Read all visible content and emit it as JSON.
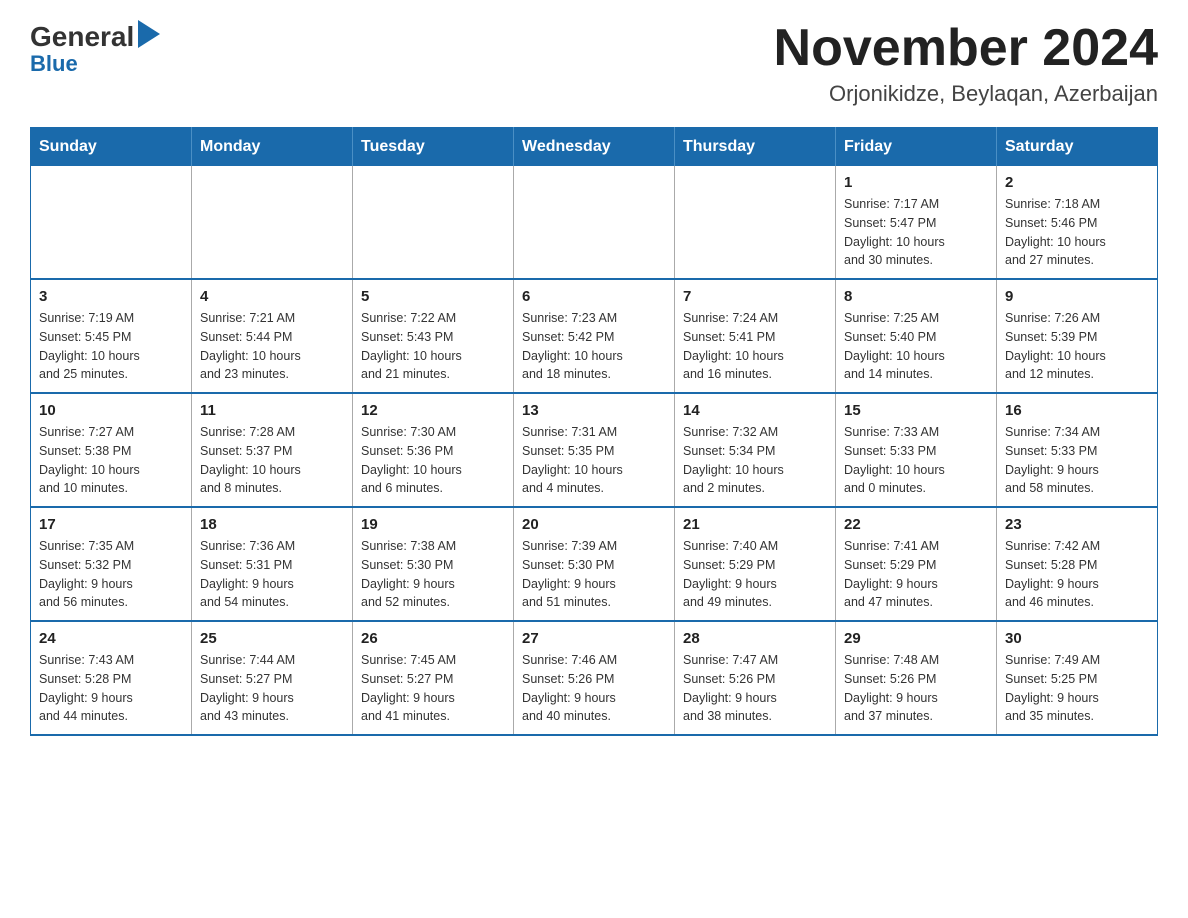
{
  "header": {
    "logo_general": "General",
    "logo_blue": "Blue",
    "month_title": "November 2024",
    "location": "Orjonikidze, Beylaqan, Azerbaijan"
  },
  "calendar": {
    "weekdays": [
      "Sunday",
      "Monday",
      "Tuesday",
      "Wednesday",
      "Thursday",
      "Friday",
      "Saturday"
    ],
    "weeks": [
      [
        {
          "day": "",
          "info": ""
        },
        {
          "day": "",
          "info": ""
        },
        {
          "day": "",
          "info": ""
        },
        {
          "day": "",
          "info": ""
        },
        {
          "day": "",
          "info": ""
        },
        {
          "day": "1",
          "info": "Sunrise: 7:17 AM\nSunset: 5:47 PM\nDaylight: 10 hours\nand 30 minutes."
        },
        {
          "day": "2",
          "info": "Sunrise: 7:18 AM\nSunset: 5:46 PM\nDaylight: 10 hours\nand 27 minutes."
        }
      ],
      [
        {
          "day": "3",
          "info": "Sunrise: 7:19 AM\nSunset: 5:45 PM\nDaylight: 10 hours\nand 25 minutes."
        },
        {
          "day": "4",
          "info": "Sunrise: 7:21 AM\nSunset: 5:44 PM\nDaylight: 10 hours\nand 23 minutes."
        },
        {
          "day": "5",
          "info": "Sunrise: 7:22 AM\nSunset: 5:43 PM\nDaylight: 10 hours\nand 21 minutes."
        },
        {
          "day": "6",
          "info": "Sunrise: 7:23 AM\nSunset: 5:42 PM\nDaylight: 10 hours\nand 18 minutes."
        },
        {
          "day": "7",
          "info": "Sunrise: 7:24 AM\nSunset: 5:41 PM\nDaylight: 10 hours\nand 16 minutes."
        },
        {
          "day": "8",
          "info": "Sunrise: 7:25 AM\nSunset: 5:40 PM\nDaylight: 10 hours\nand 14 minutes."
        },
        {
          "day": "9",
          "info": "Sunrise: 7:26 AM\nSunset: 5:39 PM\nDaylight: 10 hours\nand 12 minutes."
        }
      ],
      [
        {
          "day": "10",
          "info": "Sunrise: 7:27 AM\nSunset: 5:38 PM\nDaylight: 10 hours\nand 10 minutes."
        },
        {
          "day": "11",
          "info": "Sunrise: 7:28 AM\nSunset: 5:37 PM\nDaylight: 10 hours\nand 8 minutes."
        },
        {
          "day": "12",
          "info": "Sunrise: 7:30 AM\nSunset: 5:36 PM\nDaylight: 10 hours\nand 6 minutes."
        },
        {
          "day": "13",
          "info": "Sunrise: 7:31 AM\nSunset: 5:35 PM\nDaylight: 10 hours\nand 4 minutes."
        },
        {
          "day": "14",
          "info": "Sunrise: 7:32 AM\nSunset: 5:34 PM\nDaylight: 10 hours\nand 2 minutes."
        },
        {
          "day": "15",
          "info": "Sunrise: 7:33 AM\nSunset: 5:33 PM\nDaylight: 10 hours\nand 0 minutes."
        },
        {
          "day": "16",
          "info": "Sunrise: 7:34 AM\nSunset: 5:33 PM\nDaylight: 9 hours\nand 58 minutes."
        }
      ],
      [
        {
          "day": "17",
          "info": "Sunrise: 7:35 AM\nSunset: 5:32 PM\nDaylight: 9 hours\nand 56 minutes."
        },
        {
          "day": "18",
          "info": "Sunrise: 7:36 AM\nSunset: 5:31 PM\nDaylight: 9 hours\nand 54 minutes."
        },
        {
          "day": "19",
          "info": "Sunrise: 7:38 AM\nSunset: 5:30 PM\nDaylight: 9 hours\nand 52 minutes."
        },
        {
          "day": "20",
          "info": "Sunrise: 7:39 AM\nSunset: 5:30 PM\nDaylight: 9 hours\nand 51 minutes."
        },
        {
          "day": "21",
          "info": "Sunrise: 7:40 AM\nSunset: 5:29 PM\nDaylight: 9 hours\nand 49 minutes."
        },
        {
          "day": "22",
          "info": "Sunrise: 7:41 AM\nSunset: 5:29 PM\nDaylight: 9 hours\nand 47 minutes."
        },
        {
          "day": "23",
          "info": "Sunrise: 7:42 AM\nSunset: 5:28 PM\nDaylight: 9 hours\nand 46 minutes."
        }
      ],
      [
        {
          "day": "24",
          "info": "Sunrise: 7:43 AM\nSunset: 5:28 PM\nDaylight: 9 hours\nand 44 minutes."
        },
        {
          "day": "25",
          "info": "Sunrise: 7:44 AM\nSunset: 5:27 PM\nDaylight: 9 hours\nand 43 minutes."
        },
        {
          "day": "26",
          "info": "Sunrise: 7:45 AM\nSunset: 5:27 PM\nDaylight: 9 hours\nand 41 minutes."
        },
        {
          "day": "27",
          "info": "Sunrise: 7:46 AM\nSunset: 5:26 PM\nDaylight: 9 hours\nand 40 minutes."
        },
        {
          "day": "28",
          "info": "Sunrise: 7:47 AM\nSunset: 5:26 PM\nDaylight: 9 hours\nand 38 minutes."
        },
        {
          "day": "29",
          "info": "Sunrise: 7:48 AM\nSunset: 5:26 PM\nDaylight: 9 hours\nand 37 minutes."
        },
        {
          "day": "30",
          "info": "Sunrise: 7:49 AM\nSunset: 5:25 PM\nDaylight: 9 hours\nand 35 minutes."
        }
      ]
    ]
  }
}
